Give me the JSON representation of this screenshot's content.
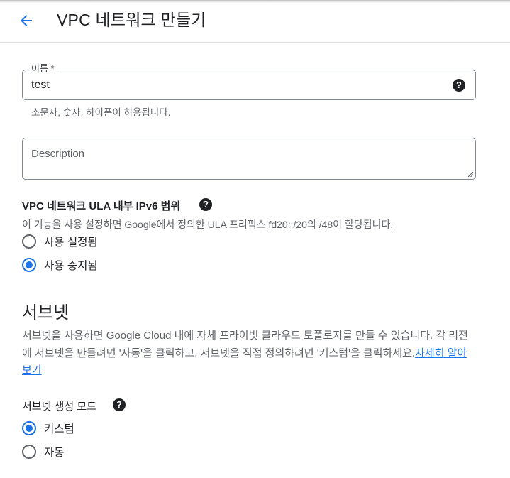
{
  "header": {
    "title": "VPC 네트워크 만들기",
    "back_icon": "arrow-left-icon"
  },
  "name_field": {
    "label": "이름 *",
    "value": "test",
    "help_icon": "help-icon",
    "hint": "소문자, 숫자, 하이픈이 허용됩니다."
  },
  "description_field": {
    "placeholder": "Description"
  },
  "ula": {
    "label": "VPC 네트워크 ULA 내부 IPv6 범위",
    "description": "이 기능을 사용 설정하면 Google에서 정의한 ULA 프리픽스 fd20::/20의 /48이 할당됩니다.",
    "options": [
      {
        "label": "사용 설정됨",
        "selected": false
      },
      {
        "label": "사용 중지됨",
        "selected": true
      }
    ]
  },
  "subnets": {
    "title": "서브넷",
    "description": "서브넷을 사용하면 Google Cloud 내에 자체 프라이빗 클라우드 토폴로지를 만들 수 있습니다. 각 리전에 서브넷을 만들려면 '자동'을 클릭하고, 서브넷을 직접 정의하려면 '커스텀'을 클릭하세요.",
    "learn_more": "자세히 알아보기",
    "mode_label": "서브넷 생성 모드",
    "mode_options": [
      {
        "label": "커스텀",
        "selected": true
      },
      {
        "label": "자동",
        "selected": false
      }
    ]
  },
  "colors": {
    "accent": "#1a73e8",
    "text": "#202124",
    "secondary_text": "#5f6368",
    "border": "#80868b"
  }
}
